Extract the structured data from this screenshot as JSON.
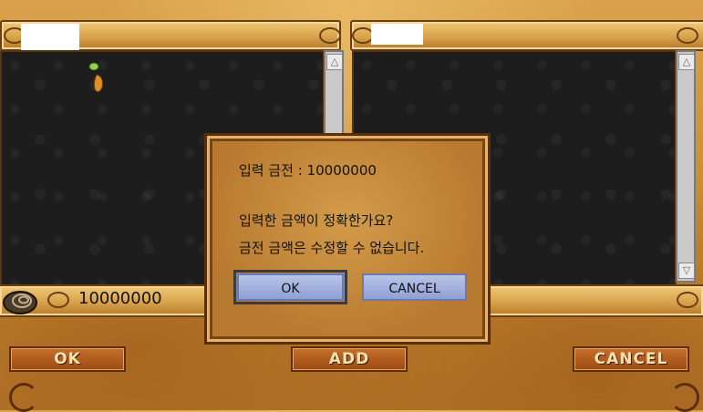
{
  "trade": {
    "money_amount": "10000000",
    "ok_label": "OK",
    "add_label": "ADD",
    "cancel_label": "CANCEL",
    "scroll_up": "△",
    "scroll_down": "▽"
  },
  "dialog": {
    "input_line": "입력 금전 : 10000000",
    "question_line": "입력한 금액이 정확한가요?",
    "warning_line": "금전 금액은 수정할 수 없습니다.",
    "ok_label": "OK",
    "cancel_label": "CANCEL"
  },
  "icons": [
    "item-icon",
    "coin-pouch-icon",
    "scroll-up-icon",
    "scroll-down-icon"
  ]
}
